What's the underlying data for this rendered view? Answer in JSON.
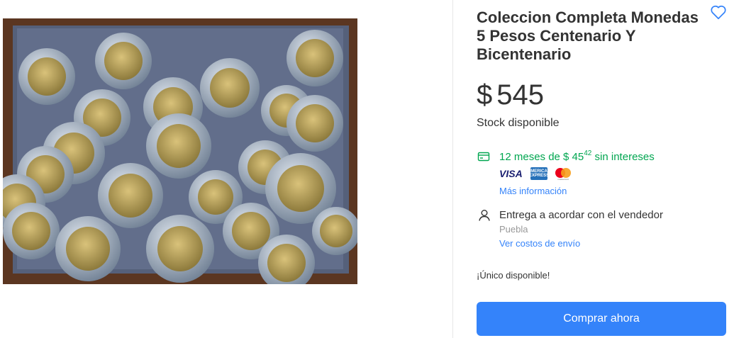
{
  "product": {
    "title": "Coleccion Completa Monedas 5 Pesos Centenario Y Bicentenario",
    "price": {
      "currency": "$",
      "amount": "545"
    },
    "stock": "Stock disponible"
  },
  "installments": {
    "prefix": "12 meses de $ 45",
    "cents": "42",
    "suffix": " sin intereses",
    "cards": {
      "visa": "VISA",
      "amex": "AMERICAN EXPRESS",
      "mastercard": "mastercard"
    },
    "more_info": "Más información"
  },
  "shipping": {
    "delivery": "Entrega a acordar con el vendedor",
    "location": "Puebla",
    "costs_link": "Ver costos de envío"
  },
  "availability": "¡Único disponible!",
  "actions": {
    "buy_now": "Comprar ahora"
  },
  "colors": {
    "accent": "#3483fa",
    "green": "#00a650",
    "text": "#333333"
  },
  "icons": [
    "heart-icon",
    "credit-card-icon",
    "person-icon"
  ]
}
